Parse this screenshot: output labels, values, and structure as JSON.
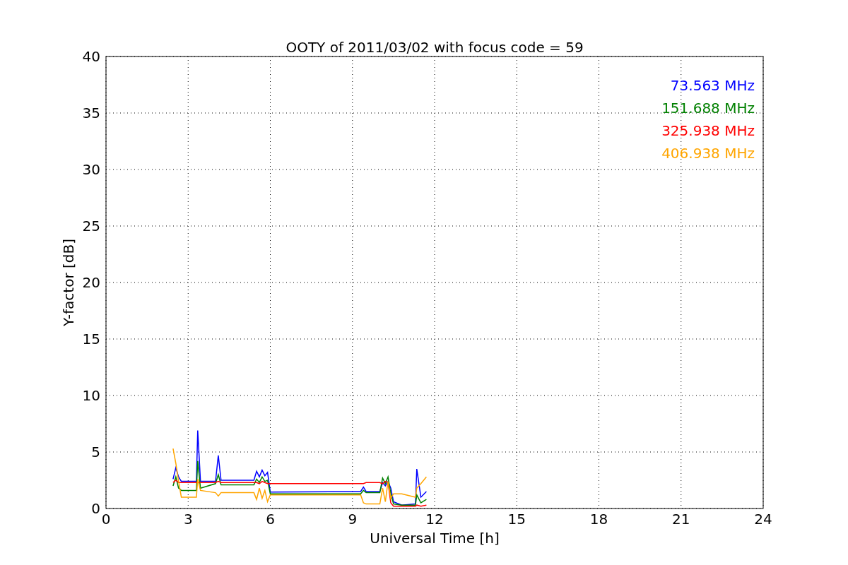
{
  "chart_data": {
    "type": "line",
    "title": "OOTY of 2011/03/02 with focus code = 59",
    "xlabel": "Universal Time [h]",
    "ylabel": "Y-factor [dB]",
    "xlim": [
      0,
      24
    ],
    "ylim": [
      0,
      40
    ],
    "grid": true,
    "xticks": [
      0,
      3,
      6,
      9,
      12,
      15,
      18,
      21,
      24
    ],
    "yticks": [
      0,
      5,
      10,
      15,
      20,
      25,
      30,
      35,
      40
    ],
    "x": [
      2.45,
      2.55,
      2.65,
      2.75,
      3.3,
      3.35,
      3.45,
      4.0,
      4.1,
      4.2,
      5.4,
      5.5,
      5.6,
      5.7,
      5.8,
      5.9,
      6.0,
      9.3,
      9.4,
      9.5,
      10.0,
      10.1,
      10.2,
      10.3,
      10.4,
      10.5,
      10.8,
      11.3,
      11.35,
      11.5,
      11.7
    ],
    "series": [
      {
        "name": "73.563 MHz",
        "color": "#0000ff",
        "values": [
          2.6,
          3.6,
          2.8,
          2.4,
          2.4,
          6.9,
          2.4,
          2.4,
          4.7,
          2.5,
          2.5,
          3.3,
          2.8,
          3.4,
          2.9,
          3.2,
          1.45,
          1.5,
          1.9,
          1.5,
          1.5,
          2.3,
          2.0,
          2.4,
          1.8,
          0.6,
          0.3,
          0.4,
          3.5,
          1.0,
          1.5
        ]
      },
      {
        "name": "151.688 MHz",
        "color": "#008000",
        "values": [
          2.0,
          2.8,
          1.8,
          1.6,
          1.6,
          4.2,
          1.8,
          2.2,
          3.0,
          2.1,
          2.1,
          2.6,
          2.3,
          2.8,
          2.4,
          2.5,
          1.3,
          1.3,
          1.6,
          1.4,
          1.4,
          2.7,
          2.2,
          2.8,
          1.3,
          0.4,
          0.3,
          0.3,
          1.2,
          0.5,
          0.8
        ]
      },
      {
        "name": "325.938 MHz",
        "color": "#ff0000",
        "values": [
          2.3,
          2.5,
          2.3,
          2.3,
          2.3,
          2.3,
          2.3,
          2.3,
          2.4,
          2.3,
          2.3,
          2.3,
          2.2,
          2.4,
          2.3,
          2.2,
          2.2,
          2.2,
          2.2,
          2.3,
          2.3,
          2.2,
          2.4,
          2.3,
          0.5,
          0.2,
          0.2,
          0.2,
          0.3,
          0.2,
          0.3
        ]
      },
      {
        "name": "406.938 MHz",
        "color": "#ffa500",
        "values": [
          5.3,
          4.0,
          2.4,
          1.0,
          1.0,
          2.6,
          1.6,
          1.4,
          1.1,
          1.4,
          1.4,
          0.8,
          1.8,
          0.9,
          1.6,
          0.6,
          1.2,
          1.2,
          0.5,
          0.4,
          0.4,
          1.8,
          0.6,
          2.4,
          0.9,
          1.3,
          1.3,
          1.0,
          1.8,
          2.2,
          2.8
        ]
      }
    ]
  }
}
